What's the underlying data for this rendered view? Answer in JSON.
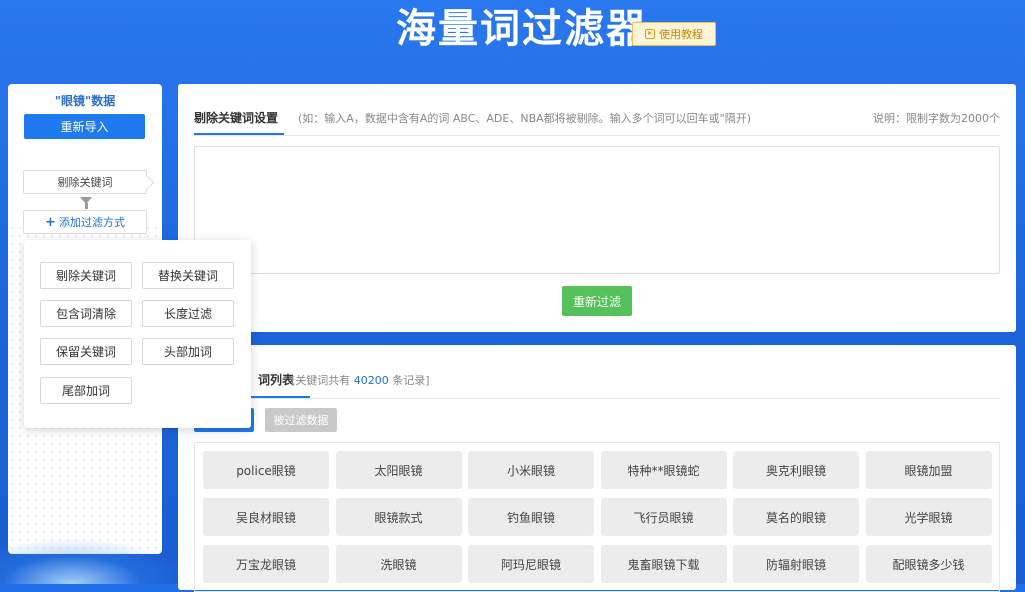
{
  "header": {
    "title": "海量词过滤器",
    "tutorial_label": "使用教程"
  },
  "sidebar": {
    "title": "\"眼镜\"数据",
    "reimport_label": "重新导入",
    "step_label": "剔除关键词",
    "add_filter_label": "添加过滤方式"
  },
  "popup": {
    "options": [
      "剔除关键词",
      "替换关键词",
      "包含词清除",
      "长度过滤",
      "保留关键词",
      "头部加词",
      "尾部加词"
    ]
  },
  "panel1": {
    "tab_label": "剔除关键词设置",
    "hint": "(如：输入A，数据中含有A的词 ABC、ADE、NBA都将被剔除。输入多个词可以回车或\"隔开)",
    "limit": "说明：限制字数为2000个",
    "textarea_value": "",
    "refilter_label": "重新过滤"
  },
  "panel2": {
    "tab_label": "词列表",
    "info_prefix": "[关键词共有",
    "count": "40200",
    "info_suffix": "条记录]",
    "filtered_label": "被过滤数据",
    "keywords": [
      "police眼镜",
      "太阳眼镜",
      "小米眼镜",
      "特种**眼镜蛇",
      "奥克利眼镜",
      "眼镜加盟",
      "吴良材眼镜",
      "眼镜款式",
      "钓鱼眼镜",
      "飞行员眼镜",
      "莫名的眼镜",
      "光学眼镜",
      "万宝龙眼镜",
      "洗眼镜",
      "阿玛尼眼镜",
      "鬼畜眼镜下载",
      "防辐射眼镜",
      "配眼镜多少钱"
    ]
  },
  "colors": {
    "primary": "#1f7af0",
    "background": "#1e6fe8",
    "success": "#56c05a",
    "count_blue": "#1f6fd8"
  }
}
